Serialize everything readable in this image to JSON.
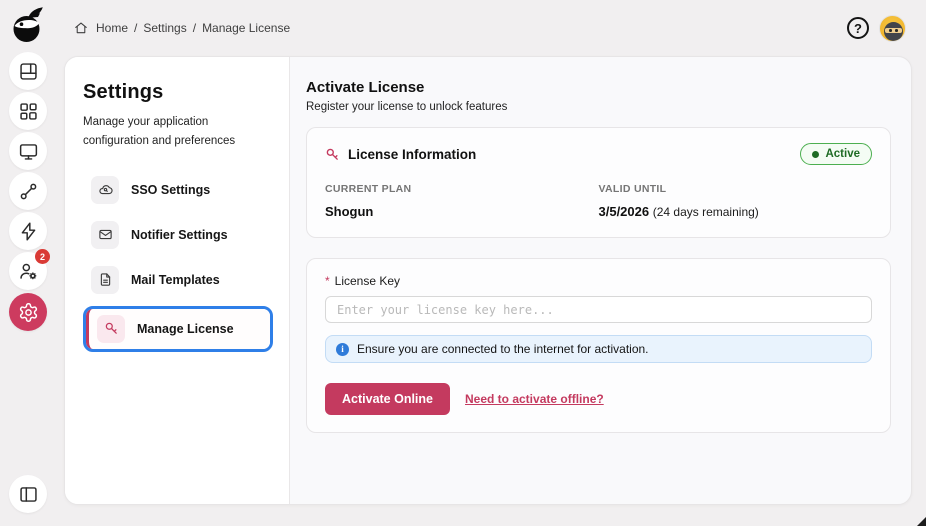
{
  "colors": {
    "accent_crimson": "#c43a5f",
    "selection_blue": "#2f7fe8",
    "status_green": "#1e6b24",
    "info_blue": "#2f7bd9",
    "badge_red": "#d93a35"
  },
  "rail": {
    "badge_count": "2",
    "icons": [
      "brand-logo",
      "layout-panels-icon",
      "app-grid-icon",
      "monitor-icon",
      "git-branch-icon",
      "zap-icon",
      "user-settings-icon",
      "settings-gear-icon",
      "panel-toggle-icon"
    ]
  },
  "topbar": {
    "breadcrumb": {
      "home": "Home",
      "separator": "/",
      "section": "Settings",
      "current": "Manage License"
    },
    "help_glyph": "?"
  },
  "settings_panel": {
    "title": "Settings",
    "description": "Manage your application configuration and preferences",
    "items": [
      {
        "label": "SSO Settings",
        "icon": "cloud-sso-icon"
      },
      {
        "label": "Notifier Settings",
        "icon": "mail-icon"
      },
      {
        "label": "Mail Templates",
        "icon": "file-text-icon"
      },
      {
        "label": "Manage License",
        "icon": "key-icon"
      }
    ]
  },
  "main": {
    "title": "Activate License",
    "subtitle": "Register your license to unlock features",
    "license_info": {
      "title": "License Information",
      "status_badge": "Active",
      "current_plan_label": "CURRENT PLAN",
      "current_plan_value": "Shogun",
      "valid_until_label": "VALID UNTIL",
      "valid_until_value": "3/5/2026",
      "valid_until_note": "(24 days remaining)"
    },
    "form": {
      "required_marker": "*",
      "license_key_label": "License Key",
      "placeholder": "Enter your license key here...",
      "info_note": "Ensure you are connected to the internet for activation.",
      "activate_button_label": "Activate Online",
      "offline_link_label": "Need to activate offline?"
    }
  }
}
